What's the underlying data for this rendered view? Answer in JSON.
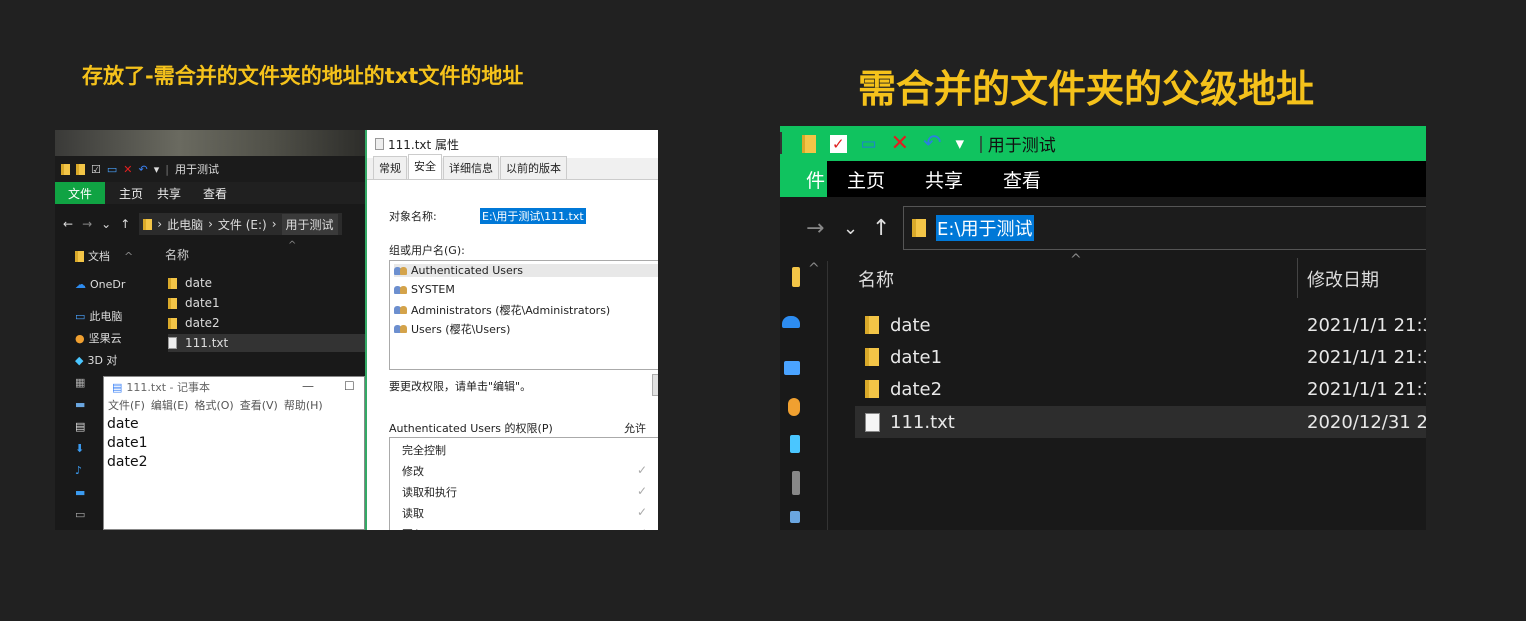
{
  "headings": {
    "left": "存放了-需合并的文件夹的地址的txt文件的地址",
    "right": "需合并的文件夹的父级地址"
  },
  "left_explorer": {
    "qat_title": "用于测试",
    "ribbon_tabs": [
      "文件",
      "主页",
      "共享",
      "查看"
    ],
    "breadcrumb": [
      "此电脑",
      "文件 (E:)",
      "用于测试"
    ],
    "nav_items": [
      "文档",
      "OneDr",
      "此电脑",
      "坚果云",
      "3D 对"
    ],
    "column_name": "名称",
    "files": [
      "date",
      "date1",
      "date2",
      "111.txt"
    ]
  },
  "notepad": {
    "title": "111.txt - 记事本",
    "menu": [
      "文件(F)",
      "编辑(E)",
      "格式(O)",
      "查看(V)",
      "帮助(H)"
    ],
    "lines": [
      "date",
      "date1",
      "date2"
    ]
  },
  "properties": {
    "title": "111.txt 属性",
    "tabs": [
      "常规",
      "安全",
      "详细信息",
      "以前的版本"
    ],
    "object_label": "对象名称:",
    "object_value": "E:\\用于测试\\111.txt",
    "group_label": "组或用户名(G):",
    "groups": [
      "Authenticated Users",
      "SYSTEM",
      "Administrators (樱花\\Administrators)",
      "Users (樱花\\Users)"
    ],
    "edit_hint": "要更改权限，请单击\"编辑\"。",
    "perm_label": "Authenticated Users 的权限(P)",
    "allow_label": "允许",
    "permissions": [
      "完全控制",
      "修改",
      "读取和执行",
      "读取",
      "写入"
    ]
  },
  "right_explorer": {
    "qat_title": "用于测试",
    "ribbon_tabs": [
      "件",
      "主页",
      "共享",
      "查看"
    ],
    "address": "E:\\用于测试",
    "col_name": "名称",
    "col_date": "修改日期",
    "rows": [
      {
        "name": "date",
        "date": "2021/1/1 21:3",
        "type": "folder"
      },
      {
        "name": "date1",
        "date": "2021/1/1 21:3",
        "type": "folder"
      },
      {
        "name": "date2",
        "date": "2021/1/1 21:3",
        "type": "folder"
      },
      {
        "name": "111.txt",
        "date": "2020/12/31 2",
        "type": "txt"
      }
    ]
  },
  "colors": {
    "heading": "#f5c21b",
    "accent_green": "#10c35f",
    "selection_blue": "#0078d7",
    "background": "#212121"
  }
}
